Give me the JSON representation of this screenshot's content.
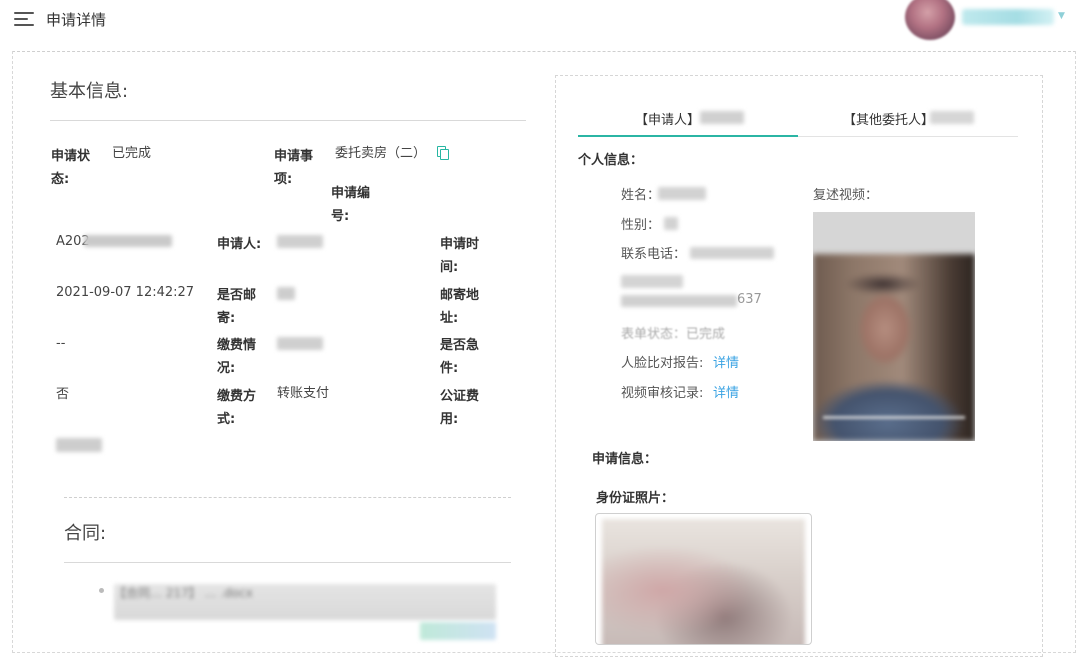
{
  "header": {
    "title": "申请详情",
    "username": "",
    "icons": {
      "menu": "menu-icon",
      "caret": "chevron-down-icon"
    }
  },
  "basic": {
    "title": "基本信息:",
    "status_label": "申请状态:",
    "status_value": "已完成",
    "matter_label": "申请事项:",
    "matter_value": "委托卖房（二）",
    "number_label": "申请编号:",
    "number_value": "A202",
    "applicant_label": "申请人:",
    "apply_time_label": "申请时间:",
    "apply_time_value": "2021-09-07 12:42:27",
    "is_mail_label": "是否邮寄:",
    "mail_address_label": "邮寄地址:",
    "mail_address_value": "--",
    "payment_status_label": "缴费情况:",
    "urgent_label": "是否急件:",
    "urgent_value": "否",
    "payment_method_label": "缴费方式:",
    "payment_method_value": "转账支付",
    "notary_fee_label": "公证费用:"
  },
  "contract": {
    "title": "合同:",
    "file_name": "【合同… 217】 … .docx"
  },
  "applicant_panel": {
    "tabs": [
      {
        "label": "【申请人】",
        "active": true
      },
      {
        "label": "【其他委托人】",
        "active": false
      }
    ],
    "personal_info_title": "个人信息：",
    "name_label": "姓名：",
    "gender_label": "性别：",
    "phone_label": "联系电话：",
    "id_number_suffix": "637",
    "form_status": "表单状态：已完成",
    "face_report_label": "人脸比对报告:",
    "face_report_link": "详情",
    "video_review_label": "视频审核记录:",
    "video_review_link": "详情",
    "video_label": "复述视频：",
    "apply_info_title": "申请信息：",
    "id_photo_label": "身份证照片："
  },
  "colors": {
    "accent": "#2bb5a4",
    "link": "#3aa3e3"
  }
}
